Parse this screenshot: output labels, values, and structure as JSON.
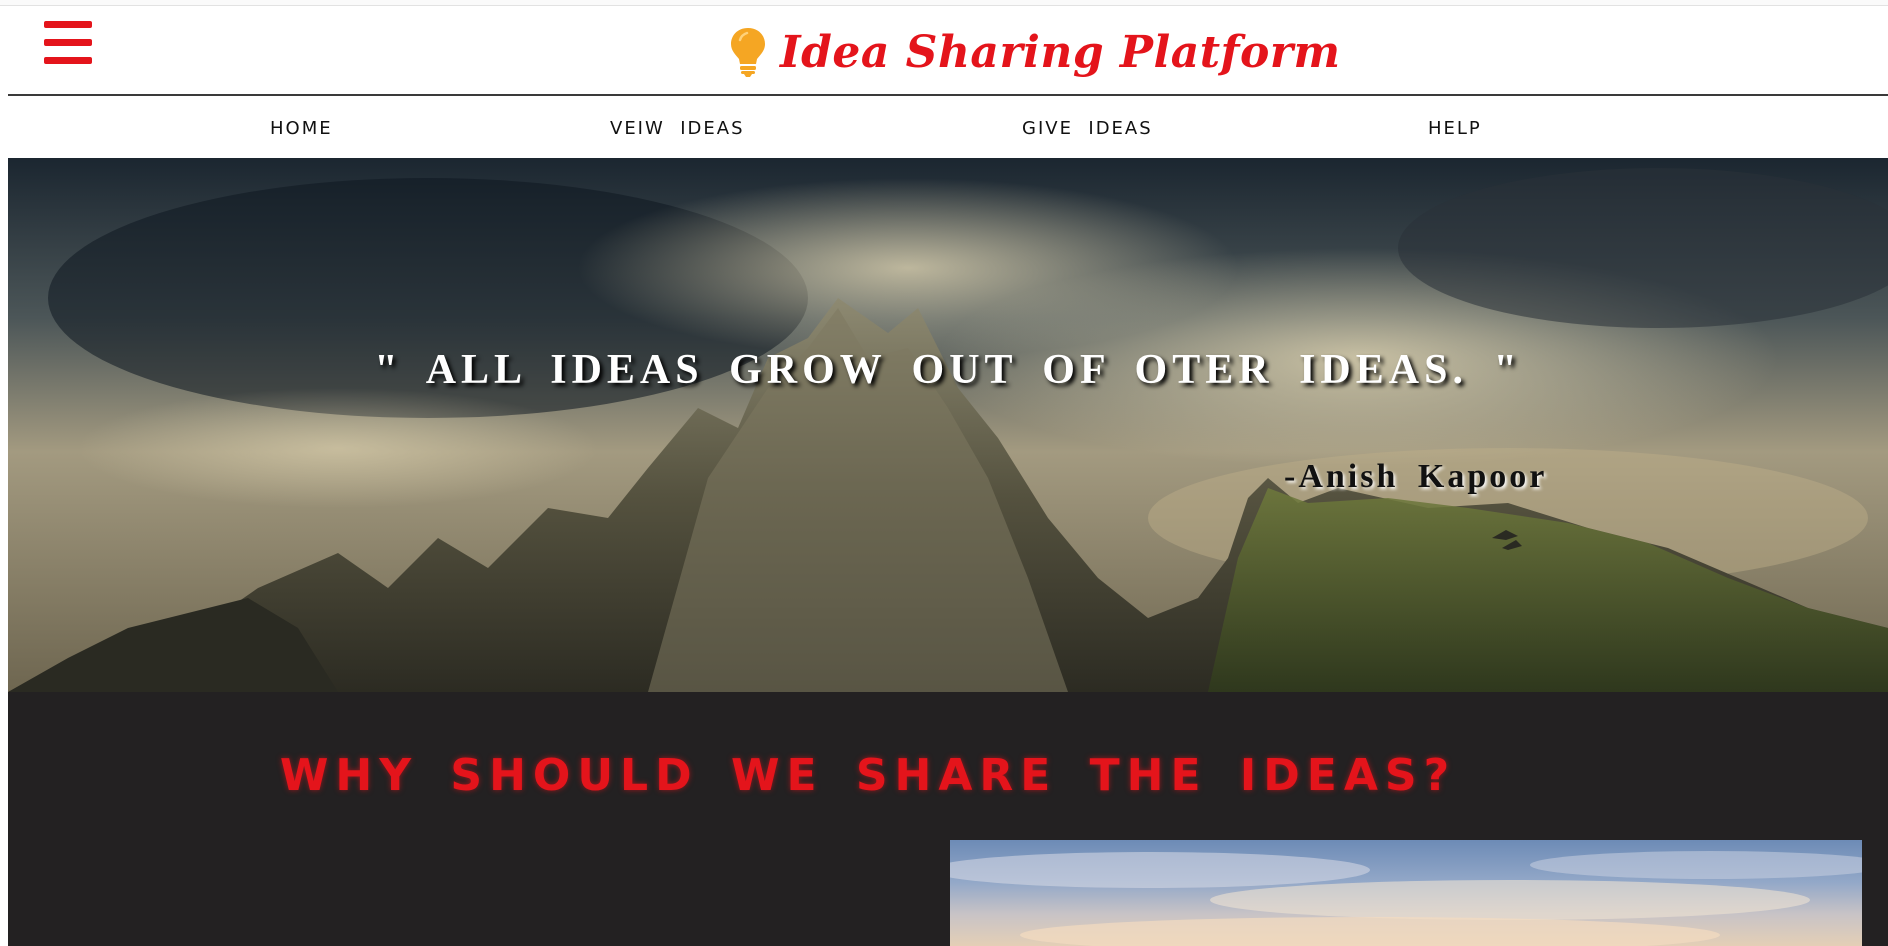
{
  "header": {
    "title": "Idea Sharing Platform",
    "menu_icon": "hamburger-menu-icon",
    "logo_icon": "lightbulb-icon",
    "brand_color": "#e4141b",
    "bulb_color": "#f5a623"
  },
  "nav": {
    "items": [
      {
        "label": "HOME"
      },
      {
        "label": "VEIW  IDEAS"
      },
      {
        "label": "GIVE  IDEAS"
      },
      {
        "label": "HELP"
      }
    ]
  },
  "hero": {
    "quote": "\" ALL IDEAS GROW OUT OF OTER IDEAS. \"",
    "author": "-Anish  Kapoor"
  },
  "why_section": {
    "title": "WHY SHOULD WE SHARE THE IDEAS?",
    "background_color": "#232122",
    "title_color": "#e4141b"
  }
}
